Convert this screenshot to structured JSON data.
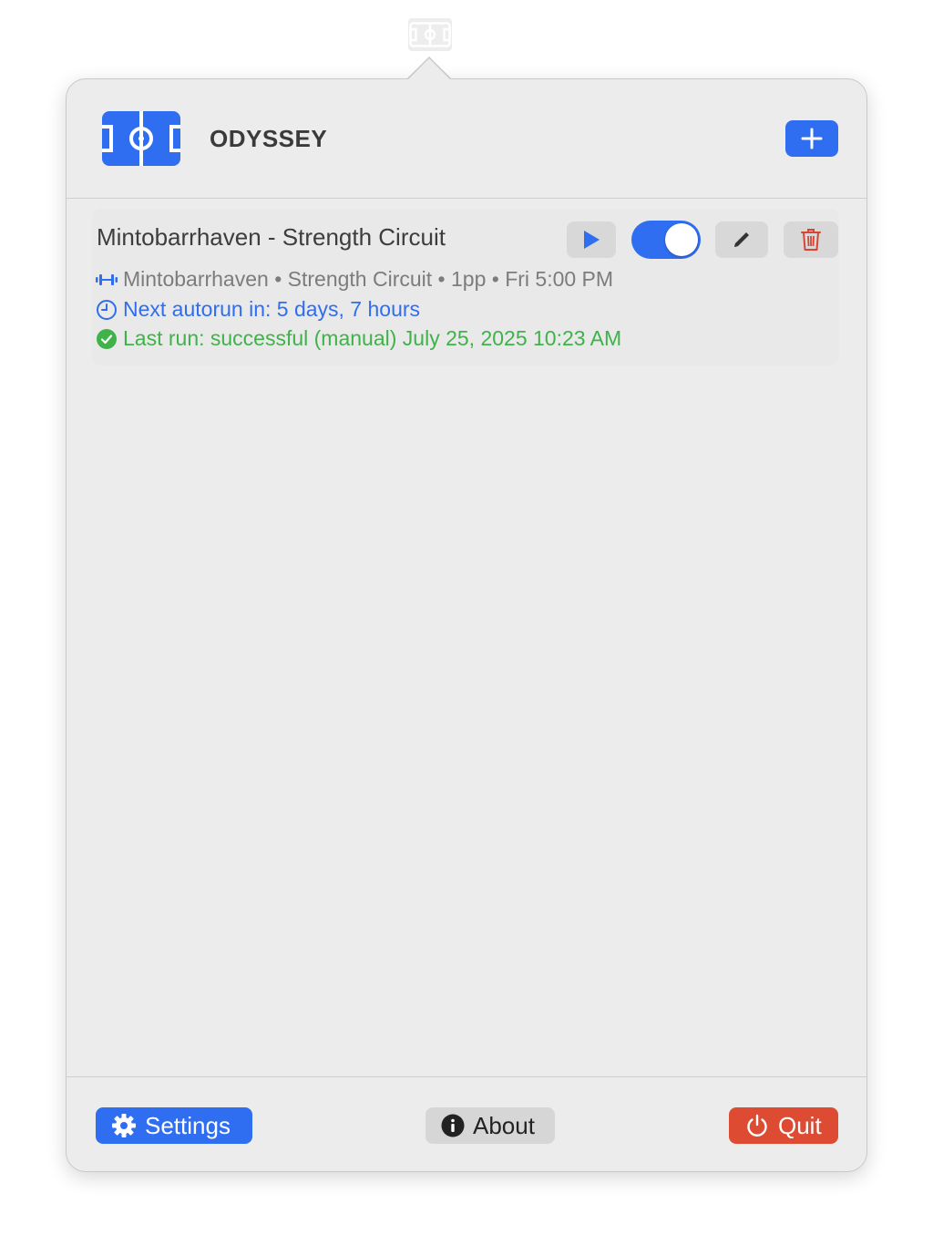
{
  "menubar": {
    "icon": "odyssey-field-icon"
  },
  "header": {
    "app_name": "ODYSSEY",
    "logo_icon": "odyssey-field-icon",
    "add_icon": "plus-icon"
  },
  "jobs": [
    {
      "title": "Mintobarrhaven - Strength Circuit",
      "enabled": true,
      "activity_icon": "dumbbell-icon",
      "meta": "Mintobarrhaven • Strength Circuit • 1pp • Fri 5:00 PM",
      "next_run": "Next autorun in: 5 days, 7 hours",
      "last_run": "Last run: successful (manual) July 25, 2025 10:23 AM",
      "controls": [
        "play-icon",
        "toggle",
        "pencil-icon",
        "trash-icon"
      ]
    }
  ],
  "footer": {
    "settings_label": "Settings",
    "about_label": "About",
    "quit_label": "Quit"
  },
  "colors": {
    "accent": "#2f6ef0",
    "success": "#3fb24a",
    "danger": "#dd4b32",
    "popover_bg": "#ececec"
  }
}
